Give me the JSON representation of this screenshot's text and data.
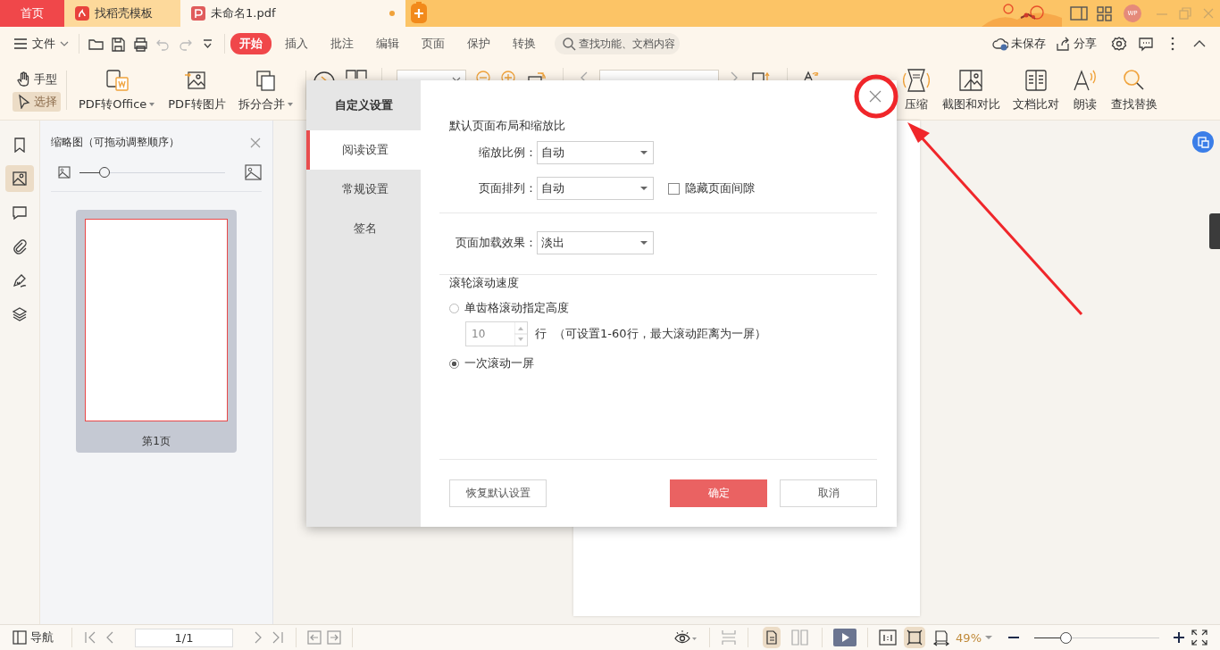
{
  "tabs": [
    {
      "label": "首页",
      "kind": "home",
      "selected": false
    },
    {
      "label": "找稻壳模板",
      "kind": "template",
      "selected": false
    },
    {
      "label": "未命名1.pdf",
      "kind": "document",
      "selected": true,
      "unsaved": true
    }
  ],
  "title_bar": {
    "avatar": "WP"
  },
  "menu": {
    "file": "文件",
    "ribbon_tabs": [
      {
        "label": "开始",
        "selected": true
      },
      {
        "label": "插入",
        "selected": false
      },
      {
        "label": "批注",
        "selected": false
      },
      {
        "label": "编辑",
        "selected": false
      },
      {
        "label": "页面",
        "selected": false
      },
      {
        "label": "保护",
        "selected": false
      },
      {
        "label": "转换",
        "selected": false
      }
    ],
    "search": {
      "placeholder": "查找功能、文档内容"
    },
    "save_status": "未保存",
    "share": "分享"
  },
  "toolbar": {
    "tools": [
      {
        "label": "手型",
        "kind": "hand",
        "selected": false
      },
      {
        "label": "选择",
        "kind": "pointer",
        "selected": true
      }
    ],
    "left_buttons": [
      {
        "label": "PDF转Office",
        "kind": "office",
        "dropdown": true
      },
      {
        "label": "PDF转图片",
        "kind": "image",
        "dropdown": false
      },
      {
        "label": "拆分合并",
        "kind": "split",
        "dropdown": true
      }
    ],
    "right_buttons": [
      {
        "label": "压缩",
        "kind": "compress"
      },
      {
        "label": "截图和对比",
        "kind": "screenshot"
      },
      {
        "label": "文档比对",
        "kind": "compare"
      },
      {
        "label": "朗读",
        "kind": "read"
      },
      {
        "label": "查找替换",
        "kind": "find"
      }
    ]
  },
  "side_icons": [
    {
      "kind": "bookmark",
      "selected": false
    },
    {
      "kind": "thumbnail",
      "selected": true
    },
    {
      "kind": "comment",
      "selected": false
    },
    {
      "kind": "attachment",
      "selected": false
    },
    {
      "kind": "signature",
      "selected": false
    },
    {
      "kind": "layers",
      "selected": false
    }
  ],
  "thumbnail_panel": {
    "title": "缩略图（可拖动调整顺序）",
    "size_slider": {
      "level": 0.17
    },
    "pages": [
      {
        "label": "第1页",
        "selected": true
      }
    ]
  },
  "dialog": {
    "title": "自定义设置",
    "nav": [
      {
        "label": "阅读设置",
        "selected": true
      },
      {
        "label": "常规设置",
        "selected": false
      },
      {
        "label": "签名",
        "selected": false
      }
    ],
    "layout_heading": "默认页面布局和缩放比",
    "zoom_field": {
      "label": "缩放比例：",
      "value": "自动"
    },
    "arrange_field": {
      "label": "页面排列：",
      "value": "自动"
    },
    "hide_gap": {
      "label": "隐藏页面间隙",
      "checked": false
    },
    "load_effect_field": {
      "label": "页面加载效果：",
      "value": "淡出"
    },
    "scroll_heading": "滚轮滚动速度",
    "scroll_options": [
      {
        "label": "单齿格滚动指定高度",
        "selected": false,
        "kind": "lines"
      },
      {
        "label": "一次滚动一屏",
        "selected": true,
        "kind": "screen"
      }
    ],
    "lines_value": "10",
    "lines_unit": "行",
    "lines_hint": "（可设置1-60行，最大滚动距离为一屏）",
    "buttons": {
      "restore": "恢复默认设置",
      "ok": "确定",
      "cancel": "取消"
    }
  },
  "status_bar": {
    "nav": "导航",
    "page": "1/1",
    "zoom": "49%",
    "zoom_slider": {
      "level": 0.25
    }
  }
}
